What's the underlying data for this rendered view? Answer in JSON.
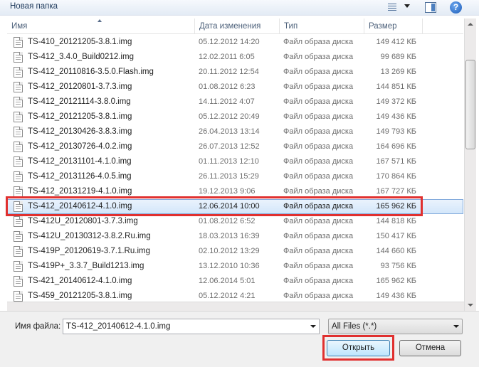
{
  "toolbar": {
    "new_folder_label": "Новая папка",
    "views_icon": "view-options-icon",
    "preview_icon": "preview-pane-icon",
    "help_icon": "help-icon"
  },
  "columns": {
    "name": "Имя",
    "date": "Дата изменения",
    "type": "Тип",
    "size": "Размер"
  },
  "files": [
    {
      "name": "TS-410_20121205-3.8.1.img",
      "date": "05.12.2012 14:20",
      "type": "Файл образа диска",
      "size": "149 412 КБ"
    },
    {
      "name": "TS-412_3.4.0_Build0212.img",
      "date": "12.02.2011 6:05",
      "type": "Файл образа диска",
      "size": "99 689 КБ"
    },
    {
      "name": "TS-412_20110816-3.5.0.Flash.img",
      "date": "20.11.2012 12:54",
      "type": "Файл образа диска",
      "size": "13 269 КБ"
    },
    {
      "name": "TS-412_20120801-3.7.3.img",
      "date": "01.08.2012 6:23",
      "type": "Файл образа диска",
      "size": "144 851 КБ"
    },
    {
      "name": "TS-412_20121114-3.8.0.img",
      "date": "14.11.2012 4:07",
      "type": "Файл образа диска",
      "size": "149 372 КБ"
    },
    {
      "name": "TS-412_20121205-3.8.1.img",
      "date": "05.12.2012 20:49",
      "type": "Файл образа диска",
      "size": "149 436 КБ"
    },
    {
      "name": "TS-412_20130426-3.8.3.img",
      "date": "26.04.2013 13:14",
      "type": "Файл образа диска",
      "size": "149 793 КБ"
    },
    {
      "name": "TS-412_20130726-4.0.2.img",
      "date": "26.07.2013 12:52",
      "type": "Файл образа диска",
      "size": "164 696 КБ"
    },
    {
      "name": "TS-412_20131101-4.1.0.img",
      "date": "01.11.2013 12:10",
      "type": "Файл образа диска",
      "size": "167 571 КБ"
    },
    {
      "name": "TS-412_20131126-4.0.5.img",
      "date": "26.11.2013 15:29",
      "type": "Файл образа диска",
      "size": "170 864 КБ"
    },
    {
      "name": "TS-412_20131219-4.1.0.img",
      "date": "19.12.2013 9:06",
      "type": "Файл образа диска",
      "size": "167 727 КБ"
    },
    {
      "name": "TS-412_20140612-4.1.0.img",
      "date": "12.06.2014 10:00",
      "type": "Файл образа диска",
      "size": "165 962 КБ"
    },
    {
      "name": "TS-412U_20120801-3.7.3.img",
      "date": "01.08.2012 6:52",
      "type": "Файл образа диска",
      "size": "144 818 КБ"
    },
    {
      "name": "TS-412U_20130312-3.8.2.Ru.img",
      "date": "18.03.2013 16:39",
      "type": "Файл образа диска",
      "size": "150 417 КБ"
    },
    {
      "name": "TS-419P_20120619-3.7.1.Ru.img",
      "date": "02.10.2012 13:29",
      "type": "Файл образа диска",
      "size": "144 660 КБ"
    },
    {
      "name": "TS-419P+_3.3.7_Build1213.img",
      "date": "13.12.2010 10:36",
      "type": "Файл образа диска",
      "size": "93 756 КБ"
    },
    {
      "name": "TS-421_20140612-4.1.0.img",
      "date": "12.06.2014 5:01",
      "type": "Файл образа диска",
      "size": "165 962 КБ"
    },
    {
      "name": "TS-459_20121205-3.8.1.img",
      "date": "05.12.2012 4:21",
      "type": "Файл образа диска",
      "size": "149 436 КБ"
    }
  ],
  "selected_index": 11,
  "footer": {
    "filename_label": "Имя файла:",
    "filename_value": "TS-412_20140612-4.1.0.img",
    "filter_value": "All Files (*.*)",
    "open_label": "Открыть",
    "cancel_label": "Отмена"
  },
  "colors": {
    "highlight": "#e0302f",
    "selection": "#d3e6fa"
  }
}
